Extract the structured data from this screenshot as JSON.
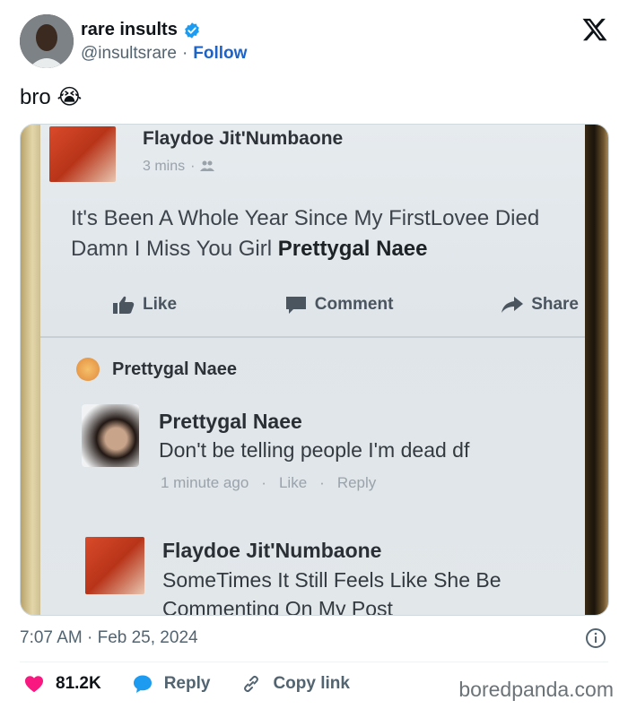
{
  "author": {
    "display_name": "rare insults",
    "handle": "@insultsrare",
    "separator": "·",
    "follow_label": "Follow",
    "verified_color": "#1d9bf0"
  },
  "tweet": {
    "text": "bro 😭"
  },
  "media": {
    "post": {
      "poster": "Flaydoe Jit'Numbaone",
      "time": "3 mins",
      "time_separator": "·",
      "audience_icon": "friends-icon",
      "body_prefix": "It's Been A Whole Year Since My FirstLovee Died Damn I Miss You Girl ",
      "body_tag": "Prettygal Naee",
      "actions": {
        "like": "Like",
        "comment": "Comment",
        "share": "Share"
      }
    },
    "reaction_row": {
      "name": "Prettygal Naee"
    },
    "comments": [
      {
        "name": "Prettygal Naee",
        "text": "Don't be telling people I'm dead df",
        "time": "1 minute ago",
        "like": "Like",
        "reply": "Reply",
        "separator": "·"
      },
      {
        "name": "Flaydoe Jit'Numbaone",
        "text": "SomeTimes It Still Feels Like She Be Commenting On My Post"
      }
    ]
  },
  "footer": {
    "timestamp": "7:07 AM · Feb 25, 2024",
    "likes": "81.2K",
    "reply_label": "Reply",
    "copy_link_label": "Copy link",
    "watermark": "boredpanda.com",
    "heart_color": "#f91880",
    "reply_color": "#1d9bf0"
  }
}
